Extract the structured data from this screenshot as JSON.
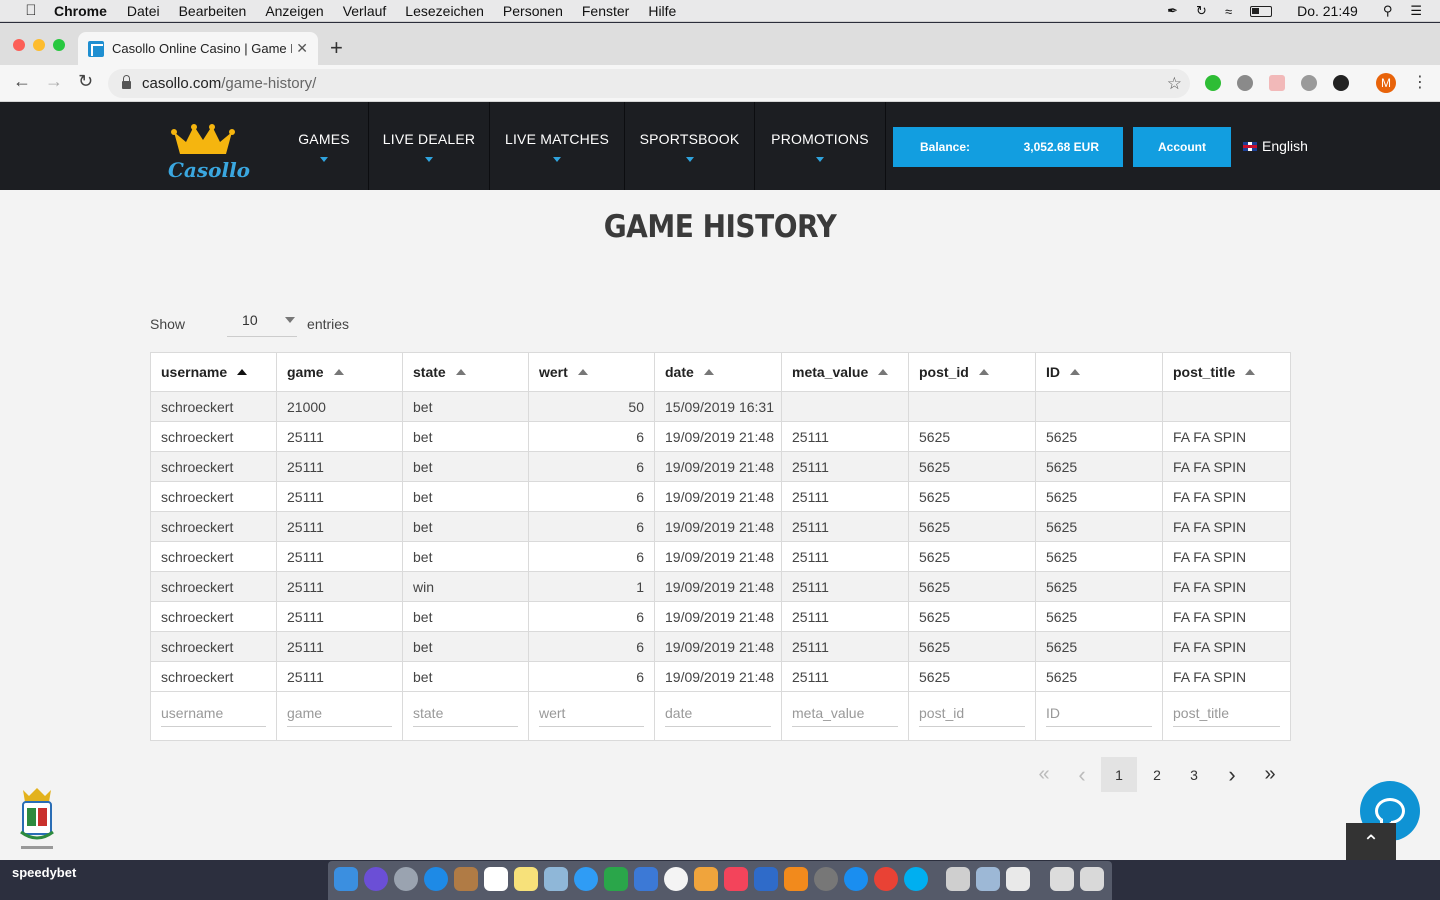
{
  "menubar": {
    "app_name": "Chrome",
    "items": [
      "Datei",
      "Bearbeiten",
      "Anzeigen",
      "Verlauf",
      "Lesezeichen",
      "Personen",
      "Fenster",
      "Hilfe"
    ],
    "clock": "Do. 21:49"
  },
  "browser": {
    "tab_title": "Casollo Online Casino | Game H",
    "url_domain": "casollo.com",
    "url_path": "/game-history/",
    "profile_initial": "M"
  },
  "site": {
    "logo_text": "Casollo",
    "nav": [
      "GAMES",
      "LIVE DEALER",
      "LIVE MATCHES",
      "SPORTSBOOK",
      "PROMOTIONS"
    ],
    "balance_label": "Balance:",
    "balance_value": "3,052.68 EUR",
    "account_label": "Account",
    "language": "English"
  },
  "page": {
    "title": "GAME HISTORY",
    "show_label": "Show",
    "show_value": "10",
    "entries_label": "entries"
  },
  "table": {
    "columns": [
      "username",
      "game",
      "state",
      "wert",
      "date",
      "meta_value",
      "post_id",
      "ID",
      "post_title"
    ],
    "rows": [
      [
        "schroeckert",
        "21000",
        "bet",
        "50",
        "15/09/2019 16:31",
        "",
        "",
        "",
        ""
      ],
      [
        "schroeckert",
        "25111",
        "bet",
        "6",
        "19/09/2019 21:48",
        "25111",
        "5625",
        "5625",
        "FA FA SPIN"
      ],
      [
        "schroeckert",
        "25111",
        "bet",
        "6",
        "19/09/2019 21:48",
        "25111",
        "5625",
        "5625",
        "FA FA SPIN"
      ],
      [
        "schroeckert",
        "25111",
        "bet",
        "6",
        "19/09/2019 21:48",
        "25111",
        "5625",
        "5625",
        "FA FA SPIN"
      ],
      [
        "schroeckert",
        "25111",
        "bet",
        "6",
        "19/09/2019 21:48",
        "25111",
        "5625",
        "5625",
        "FA FA SPIN"
      ],
      [
        "schroeckert",
        "25111",
        "bet",
        "6",
        "19/09/2019 21:48",
        "25111",
        "5625",
        "5625",
        "FA FA SPIN"
      ],
      [
        "schroeckert",
        "25111",
        "win",
        "1",
        "19/09/2019 21:48",
        "25111",
        "5625",
        "5625",
        "FA FA SPIN"
      ],
      [
        "schroeckert",
        "25111",
        "bet",
        "6",
        "19/09/2019 21:48",
        "25111",
        "5625",
        "5625",
        "FA FA SPIN"
      ],
      [
        "schroeckert",
        "25111",
        "bet",
        "6",
        "19/09/2019 21:48",
        "25111",
        "5625",
        "5625",
        "FA FA SPIN"
      ],
      [
        "schroeckert",
        "25111",
        "bet",
        "6",
        "19/09/2019 21:48",
        "25111",
        "5625",
        "5625",
        "FA FA SPIN"
      ]
    ],
    "filter_placeholders": [
      "username",
      "game",
      "state",
      "wert",
      "date",
      "meta_value",
      "post_id",
      "ID",
      "post_title"
    ]
  },
  "pagination": {
    "first": "«",
    "prev": "‹",
    "pages": [
      "1",
      "2",
      "3"
    ],
    "current": "1",
    "next": "›",
    "last": "»"
  },
  "dock": {
    "desktop_label": "speedybet"
  },
  "colors": {
    "accent": "#129ee0",
    "header_bg": "#1c1e22",
    "page_bg": "#f3f3f3"
  }
}
